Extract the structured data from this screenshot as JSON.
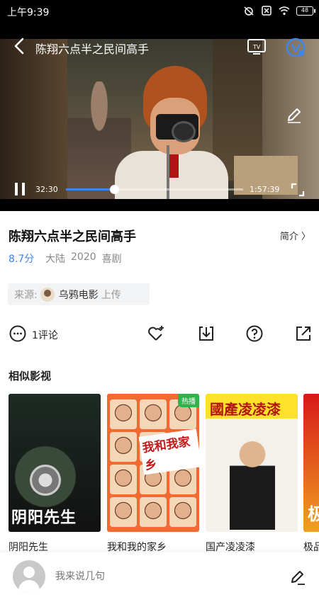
{
  "statusbar": {
    "time": "上午9:39",
    "battery": "48"
  },
  "player": {
    "title": "陈翔六点半之民间高手",
    "current_time": "32:30",
    "total_time": "1:57:39",
    "progress": 0.27,
    "accent": "#3d86f2"
  },
  "movie": {
    "title": "陈翔六点半之民间高手",
    "intro_label": "简介 〉",
    "score": "8.7分",
    "region": "大陆",
    "year": "2020",
    "genre": "喜剧"
  },
  "source": {
    "label": "来源:",
    "name": "乌鸦电影",
    "action": "上传"
  },
  "actions": {
    "comment_count": "1评论"
  },
  "similar": {
    "title": "相似影视",
    "items": [
      {
        "name": "阴阳先生",
        "poster_text": "阴阳先生"
      },
      {
        "name": "我和我的家乡",
        "poster_text": "我和我家乡",
        "badge": "热播"
      },
      {
        "name": "国产凌凌漆",
        "poster_text": "國產凌凌漆"
      },
      {
        "name": "极品",
        "poster_text": "极"
      }
    ]
  },
  "bottom": {
    "placeholder": "我来说几句"
  }
}
